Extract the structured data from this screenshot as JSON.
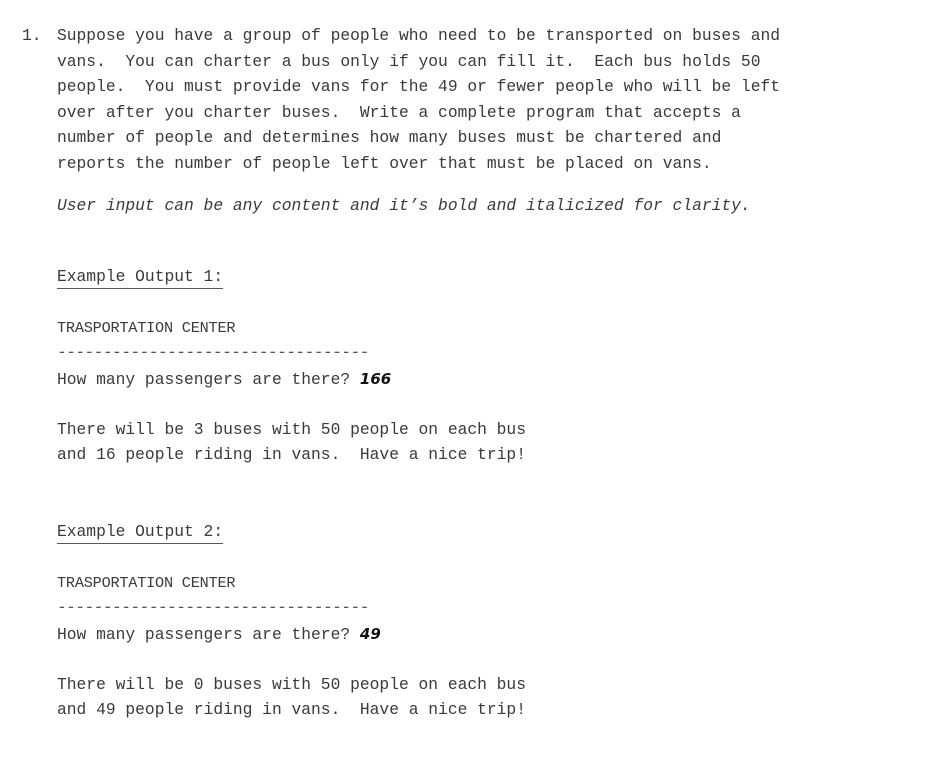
{
  "problem": {
    "number": "1.",
    "lines": [
      "Suppose you have a group of people who need to be transported on buses and",
      "vans.  You can charter a bus only if you can fill it.  Each bus holds 50",
      "people.  You must provide vans for the 49 or fewer people who will be left",
      "over after you charter buses.  Write a complete program that accepts a",
      "number of people and determines how many buses must be chartered and",
      "reports the number of people left over that must be placed on vans."
    ],
    "note": "User input can be any content and it’s bold and italicized for clarity."
  },
  "examples": [
    {
      "heading": "Example Output 1:",
      "title": "TRASPORTATION CENTER",
      "divider": "----------------------------------",
      "prompt": "How many passengers are there? ",
      "user_input": "166",
      "result_line1": "There will be 3 buses with 50 people on each bus",
      "result_line2": "and 16 people riding in vans.  Have a nice trip!"
    },
    {
      "heading": "Example Output 2:",
      "title": "TRASPORTATION CENTER",
      "divider": "----------------------------------",
      "prompt": "How many passengers are there? ",
      "user_input": "49",
      "result_line1": "There will be 0 buses with 50 people on each bus",
      "result_line2": "and 49 people riding in vans.  Have a nice trip!"
    }
  ]
}
